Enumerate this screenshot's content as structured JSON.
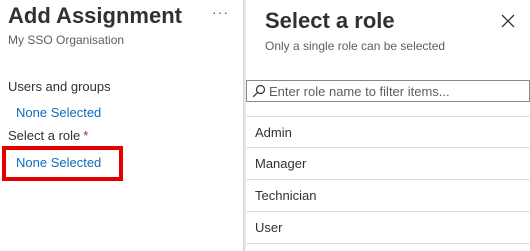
{
  "assignment": {
    "title": "Add Assignment",
    "more_label": "···",
    "organisation": "My SSO Organisation",
    "users_groups_label": "Users and groups",
    "users_groups_value": "None Selected",
    "role_label": "Select a role",
    "required_marker": "*",
    "role_value": "None Selected"
  },
  "role_panel": {
    "title": "Select a role",
    "subtitle": "Only a single role can be selected",
    "close_icon": "close-icon",
    "search_icon": "search-icon",
    "search_placeholder": "Enter role name to filter items...",
    "roles": [
      "Admin",
      "Manager",
      "Technician",
      "User"
    ]
  },
  "colors": {
    "link": "#0f6cbd",
    "highlight": "#e50000",
    "required": "#a4262c"
  }
}
